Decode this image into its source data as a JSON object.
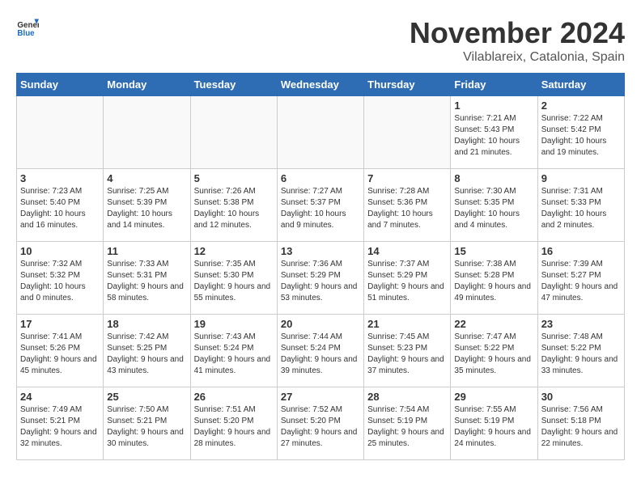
{
  "logo": {
    "general": "General",
    "blue": "Blue"
  },
  "title": "November 2024",
  "location": "Vilablareix, Catalonia, Spain",
  "headers": [
    "Sunday",
    "Monday",
    "Tuesday",
    "Wednesday",
    "Thursday",
    "Friday",
    "Saturday"
  ],
  "weeks": [
    [
      {
        "day": "",
        "info": "",
        "empty": true
      },
      {
        "day": "",
        "info": "",
        "empty": true
      },
      {
        "day": "",
        "info": "",
        "empty": true
      },
      {
        "day": "",
        "info": "",
        "empty": true
      },
      {
        "day": "",
        "info": "",
        "empty": true
      },
      {
        "day": "1",
        "info": "Sunrise: 7:21 AM\nSunset: 5:43 PM\nDaylight: 10 hours and 21 minutes."
      },
      {
        "day": "2",
        "info": "Sunrise: 7:22 AM\nSunset: 5:42 PM\nDaylight: 10 hours and 19 minutes."
      }
    ],
    [
      {
        "day": "3",
        "info": "Sunrise: 7:23 AM\nSunset: 5:40 PM\nDaylight: 10 hours and 16 minutes."
      },
      {
        "day": "4",
        "info": "Sunrise: 7:25 AM\nSunset: 5:39 PM\nDaylight: 10 hours and 14 minutes."
      },
      {
        "day": "5",
        "info": "Sunrise: 7:26 AM\nSunset: 5:38 PM\nDaylight: 10 hours and 12 minutes."
      },
      {
        "day": "6",
        "info": "Sunrise: 7:27 AM\nSunset: 5:37 PM\nDaylight: 10 hours and 9 minutes."
      },
      {
        "day": "7",
        "info": "Sunrise: 7:28 AM\nSunset: 5:36 PM\nDaylight: 10 hours and 7 minutes."
      },
      {
        "day": "8",
        "info": "Sunrise: 7:30 AM\nSunset: 5:35 PM\nDaylight: 10 hours and 4 minutes."
      },
      {
        "day": "9",
        "info": "Sunrise: 7:31 AM\nSunset: 5:33 PM\nDaylight: 10 hours and 2 minutes."
      }
    ],
    [
      {
        "day": "10",
        "info": "Sunrise: 7:32 AM\nSunset: 5:32 PM\nDaylight: 10 hours and 0 minutes."
      },
      {
        "day": "11",
        "info": "Sunrise: 7:33 AM\nSunset: 5:31 PM\nDaylight: 9 hours and 58 minutes."
      },
      {
        "day": "12",
        "info": "Sunrise: 7:35 AM\nSunset: 5:30 PM\nDaylight: 9 hours and 55 minutes."
      },
      {
        "day": "13",
        "info": "Sunrise: 7:36 AM\nSunset: 5:29 PM\nDaylight: 9 hours and 53 minutes."
      },
      {
        "day": "14",
        "info": "Sunrise: 7:37 AM\nSunset: 5:29 PM\nDaylight: 9 hours and 51 minutes."
      },
      {
        "day": "15",
        "info": "Sunrise: 7:38 AM\nSunset: 5:28 PM\nDaylight: 9 hours and 49 minutes."
      },
      {
        "day": "16",
        "info": "Sunrise: 7:39 AM\nSunset: 5:27 PM\nDaylight: 9 hours and 47 minutes."
      }
    ],
    [
      {
        "day": "17",
        "info": "Sunrise: 7:41 AM\nSunset: 5:26 PM\nDaylight: 9 hours and 45 minutes."
      },
      {
        "day": "18",
        "info": "Sunrise: 7:42 AM\nSunset: 5:25 PM\nDaylight: 9 hours and 43 minutes."
      },
      {
        "day": "19",
        "info": "Sunrise: 7:43 AM\nSunset: 5:24 PM\nDaylight: 9 hours and 41 minutes."
      },
      {
        "day": "20",
        "info": "Sunrise: 7:44 AM\nSunset: 5:24 PM\nDaylight: 9 hours and 39 minutes."
      },
      {
        "day": "21",
        "info": "Sunrise: 7:45 AM\nSunset: 5:23 PM\nDaylight: 9 hours and 37 minutes."
      },
      {
        "day": "22",
        "info": "Sunrise: 7:47 AM\nSunset: 5:22 PM\nDaylight: 9 hours and 35 minutes."
      },
      {
        "day": "23",
        "info": "Sunrise: 7:48 AM\nSunset: 5:22 PM\nDaylight: 9 hours and 33 minutes."
      }
    ],
    [
      {
        "day": "24",
        "info": "Sunrise: 7:49 AM\nSunset: 5:21 PM\nDaylight: 9 hours and 32 minutes."
      },
      {
        "day": "25",
        "info": "Sunrise: 7:50 AM\nSunset: 5:21 PM\nDaylight: 9 hours and 30 minutes."
      },
      {
        "day": "26",
        "info": "Sunrise: 7:51 AM\nSunset: 5:20 PM\nDaylight: 9 hours and 28 minutes."
      },
      {
        "day": "27",
        "info": "Sunrise: 7:52 AM\nSunset: 5:20 PM\nDaylight: 9 hours and 27 minutes."
      },
      {
        "day": "28",
        "info": "Sunrise: 7:54 AM\nSunset: 5:19 PM\nDaylight: 9 hours and 25 minutes."
      },
      {
        "day": "29",
        "info": "Sunrise: 7:55 AM\nSunset: 5:19 PM\nDaylight: 9 hours and 24 minutes."
      },
      {
        "day": "30",
        "info": "Sunrise: 7:56 AM\nSunset: 5:18 PM\nDaylight: 9 hours and 22 minutes."
      }
    ]
  ]
}
